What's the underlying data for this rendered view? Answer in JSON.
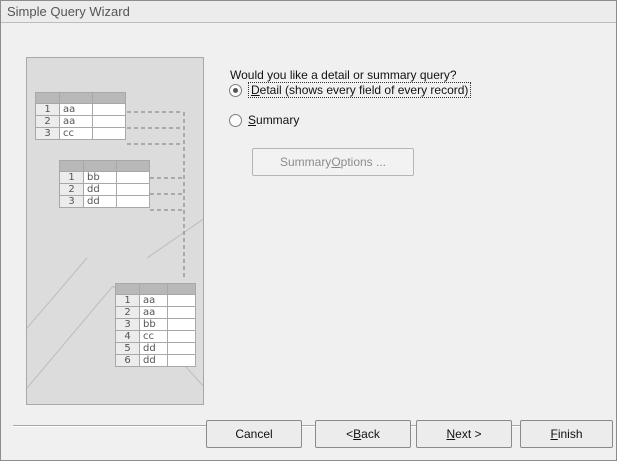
{
  "window": {
    "title": "Simple Query Wizard"
  },
  "illustration": {
    "table_top": [
      [
        "1",
        "aa"
      ],
      [
        "2",
        "aa"
      ],
      [
        "3",
        "cc"
      ]
    ],
    "table_middle": [
      [
        "1",
        "bb"
      ],
      [
        "2",
        "dd"
      ],
      [
        "3",
        "dd"
      ]
    ],
    "table_result": [
      [
        "1",
        "aa"
      ],
      [
        "2",
        "aa"
      ],
      [
        "3",
        "bb"
      ],
      [
        "4",
        "cc"
      ],
      [
        "5",
        "dd"
      ],
      [
        "6",
        "dd"
      ]
    ]
  },
  "main": {
    "question": "Would you like a detail or summary query?",
    "options": [
      {
        "hotkey": "D",
        "rest": "etail (shows every field of every record)",
        "selected": true
      },
      {
        "hotkey": "S",
        "rest": "ummary",
        "selected": false
      }
    ],
    "summary_options": {
      "before": "Summary ",
      "hotkey": "O",
      "after": "ptions ...",
      "enabled": false
    }
  },
  "footer": {
    "cancel": "Cancel",
    "back": {
      "before": "< ",
      "hotkey": "B",
      "after": "ack"
    },
    "next": {
      "hotkey": "N",
      "after": "ext >"
    },
    "finish": {
      "hotkey": "F",
      "after": "inish"
    }
  },
  "colors": {
    "window_bg": "#f0f0f0",
    "illustration_bg": "#dcdcdc",
    "header_cell": "#b8b8b8"
  }
}
